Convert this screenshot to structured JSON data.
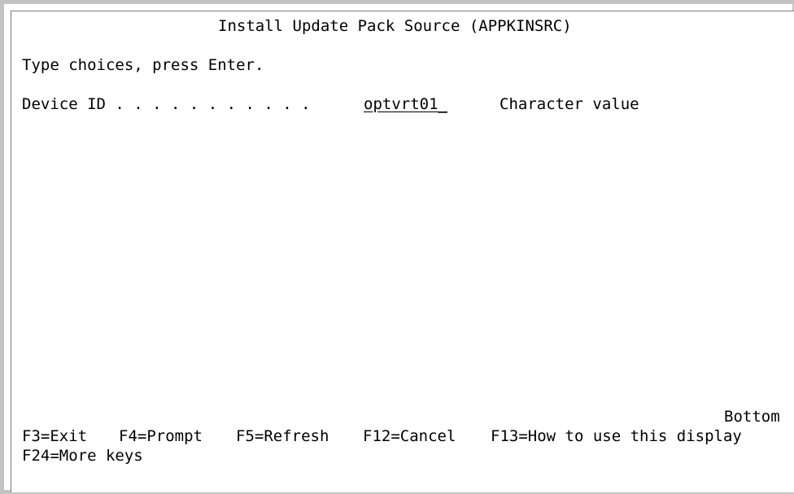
{
  "screen": {
    "title": "Install Update Pack Source (APPKINSRC)",
    "instruction": "Type choices, press Enter."
  },
  "fields": {
    "device_id": {
      "label": "Device ID . . . . . . . . . . .",
      "value": "optvrt01_",
      "hint": "Character value"
    }
  },
  "status": {
    "scroll_indicator": "Bottom"
  },
  "function_keys": {
    "f3": "F3=Exit",
    "f4": "F4=Prompt",
    "f5": "F5=Refresh",
    "f12": "F12=Cancel",
    "f13": "F13=How to use this display",
    "f24": "F24=More keys"
  }
}
